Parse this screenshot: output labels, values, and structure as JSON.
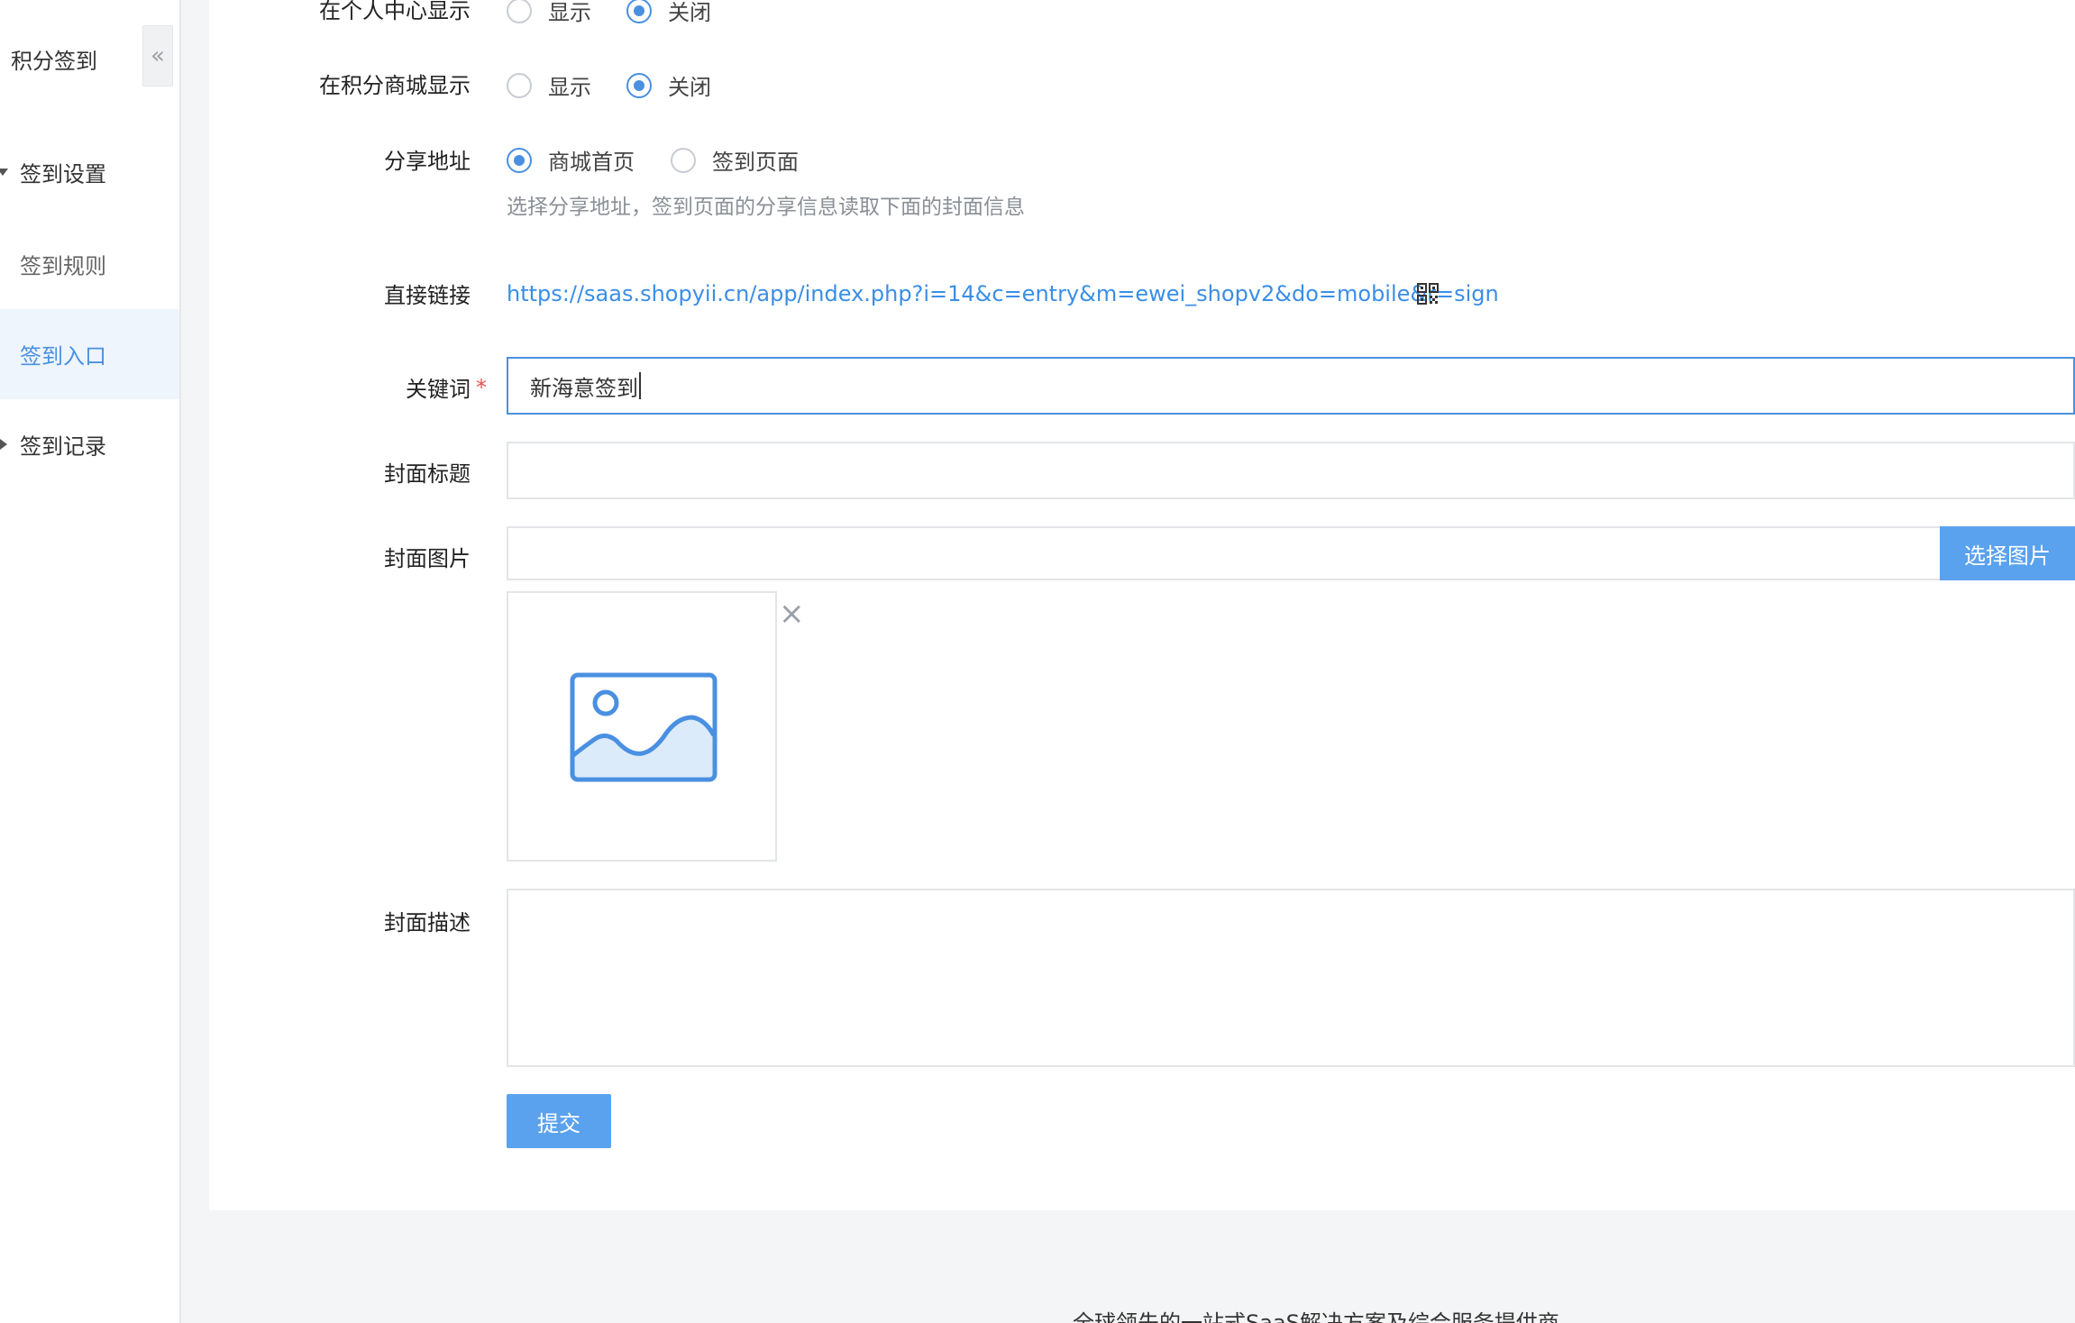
{
  "sidebar": {
    "title": "积分签到",
    "collapse_icon": "«",
    "items": [
      {
        "label": "签到设置",
        "type": "group-expanded"
      },
      {
        "label": "签到规则",
        "type": "sub"
      },
      {
        "label": "签到入口",
        "type": "sub-active"
      },
      {
        "label": "签到记录",
        "type": "group-collapsed"
      }
    ]
  },
  "form": {
    "personal_center": {
      "label": "在个人中心显示",
      "options": [
        "显示",
        "关闭"
      ],
      "selected": "关闭"
    },
    "points_mall": {
      "label": "在积分商城显示",
      "options": [
        "显示",
        "关闭"
      ],
      "selected": "关闭"
    },
    "share_address": {
      "label": "分享地址",
      "options": [
        "商城首页",
        "签到页面"
      ],
      "selected": "商城首页",
      "help": "选择分享地址，签到页面的分享信息读取下面的封面信息"
    },
    "direct_link": {
      "label": "直接链接",
      "url": "https://saas.shopyii.cn/app/index.php?i=14&c=entry&m=ewei_shopv2&do=mobile&r=sign",
      "icon": "qrcode-icon"
    },
    "keyword": {
      "label": "关键词",
      "required_mark": "*",
      "value": "新海意签到"
    },
    "cover_title": {
      "label": "封面标题",
      "value": ""
    },
    "cover_image": {
      "label": "封面图片",
      "value": "",
      "button_label": "选择图片",
      "remove_icon": "×",
      "placeholder_icon": "image-placeholder-icon"
    },
    "cover_desc": {
      "label": "封面描述",
      "value": ""
    },
    "submit_label": "提交"
  },
  "footer": {
    "text": "全球领先的一站式SaaS解决方案及综合服务提供商"
  },
  "colors": {
    "accent": "#4a90e2",
    "button": "#5aa2ee",
    "link": "#3a8ee6",
    "required": "#e25252"
  }
}
